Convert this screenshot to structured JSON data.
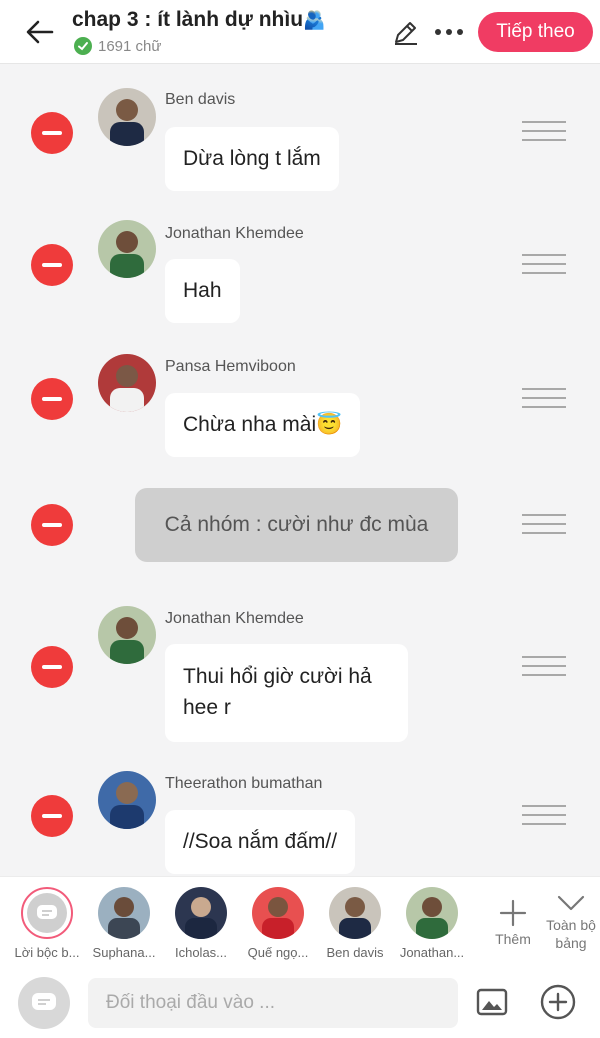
{
  "header": {
    "title": "chap 3 : ít lành dự nhìu",
    "title_emoji": "🫂",
    "word_count": "1691 chữ",
    "next_label": "Tiếp theo"
  },
  "messages": [
    {
      "name": "Ben davis",
      "text": "Dừa lòng t lắm",
      "avatar_color": "#1e2a44"
    },
    {
      "name": "Jonathan Khemdee",
      "text": "Hah",
      "avatar_color": "#2f6b3c"
    },
    {
      "name": "Pansa Hemviboon",
      "text": "Chừa nha mài😇",
      "avatar_color": "#b03a3a"
    },
    {
      "narration": "Cả nhóm : cười như đc mùa"
    },
    {
      "name": "Jonathan Khemdee",
      "text_lines": [
        "Thui hổi giờ cười hả",
        "hee r"
      ],
      "avatar_color": "#2f6b3c"
    },
    {
      "name": "Theerathon bumathan",
      "text": "//Soa nắm đấm//",
      "avatar_color": "#2a4f8f"
    }
  ],
  "characters": [
    {
      "label": "Lời bộc b...",
      "color": "#cfcfcf"
    },
    {
      "label": "Suphana...",
      "color": "#6f8aa0"
    },
    {
      "label": "Icholas...",
      "color": "#1c2740"
    },
    {
      "label": "Quế ngọ...",
      "color": "#c8202a"
    },
    {
      "label": "Ben davis",
      "color": "#1e2a44"
    },
    {
      "label": "Jonathan...",
      "color": "#2f6b3c"
    }
  ],
  "more_label": "Thêm",
  "all_board_label": "Toàn bộ bảng",
  "input": {
    "placeholder": "Đối thoại đầu vào ..."
  },
  "colors": {
    "accent": "#f03c63",
    "delete": "#ef3b3b",
    "narration_bg": "#cfcfcf"
  },
  "icons": [
    "back-arrow-icon",
    "check-icon",
    "pencil-icon",
    "more-icon",
    "minus-icon",
    "drag-handle-icon",
    "plus-icon",
    "chevron-down-icon",
    "speech-bubble-icon",
    "image-icon",
    "plus-circle-icon"
  ]
}
